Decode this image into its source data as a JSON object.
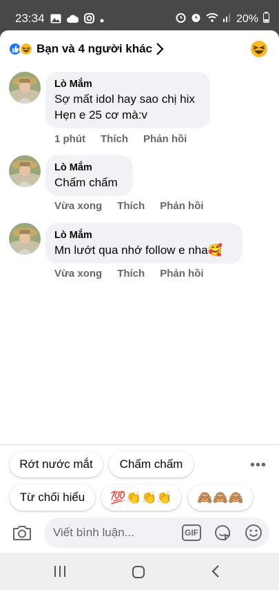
{
  "status_bar": {
    "time": "23:34",
    "battery": "20%"
  },
  "reactions": {
    "summary": "Bạn và 4 người khác"
  },
  "comments": [
    {
      "name": "Lò Mắm",
      "lines": [
        "Sợ mất idol hay sao chị hix",
        "Hẹn e 25 cơ mà:v"
      ],
      "time": "1 phút",
      "like": "Thích",
      "reply": "Phản hồi"
    },
    {
      "name": "Lò Mắm",
      "lines": [
        "Chấm chấm"
      ],
      "time": "Vừa xong",
      "like": "Thích",
      "reply": "Phản hồi"
    },
    {
      "name": "Lò Mắm",
      "lines": [
        "Mn lướt qua nhớ follow e nha🥰"
      ],
      "time": "Vừa xong",
      "like": "Thích",
      "reply": "Phản hồi"
    }
  ],
  "quick_replies": {
    "row1": [
      "Rớt nước mắt",
      "Chấm chấm"
    ],
    "row2_text": "Từ chối hiểu",
    "row2_emoji1": "💯👏👏👏",
    "row2_emoji2": "🙈🙈🙈"
  },
  "composer": {
    "placeholder": "Viết bình luận...",
    "gif_label": "GIF"
  },
  "colors": {
    "accent": "#1877f2",
    "haha": "#f7b928",
    "bubble": "#f0f2f5",
    "muted": "#65676b"
  }
}
